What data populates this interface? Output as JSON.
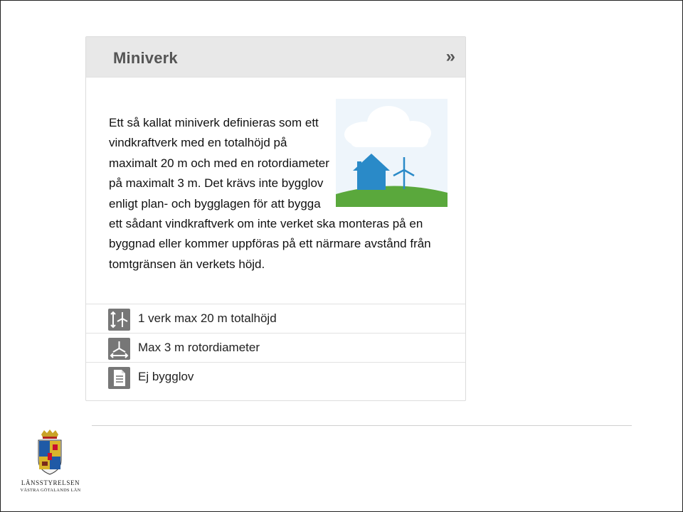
{
  "card": {
    "title": "Miniverk",
    "more_label": "»",
    "description": "Ett så kallat miniverk definieras som ett vindkraftverk med en totalhöjd på maximalt 20 m och med en rotordiameter på maximalt 3 m. Det krävs inte bygglov enligt plan- och bygglagen för att bygga ett sådant vindkraftverk om inte verket ska monteras på en byggnad eller kommer uppföras på ett närmare avstånd från tomtgränsen än verkets höjd.",
    "illustration_icons": [
      "cloud-icon",
      "house-icon",
      "wind-turbine-icon",
      "hill-icon"
    ],
    "facts": [
      {
        "icon": "turbine-height-icon",
        "label": "1 verk max 20 m totalhöjd"
      },
      {
        "icon": "rotor-icon",
        "label": "Max 3 m rotordiameter"
      },
      {
        "icon": "document-icon",
        "label": "Ej bygglov"
      }
    ]
  },
  "footer": {
    "org_line1": "LÄNSSTYRELSEN",
    "org_line2": "VÄSTRA GÖTALANDS LÄN"
  },
  "colors": {
    "header_bg": "#e8e8e8",
    "icon_gray": "#777777",
    "house_blue": "#2a8ac8",
    "hill_green": "#5aa83c",
    "sky": "#eef5fb"
  }
}
